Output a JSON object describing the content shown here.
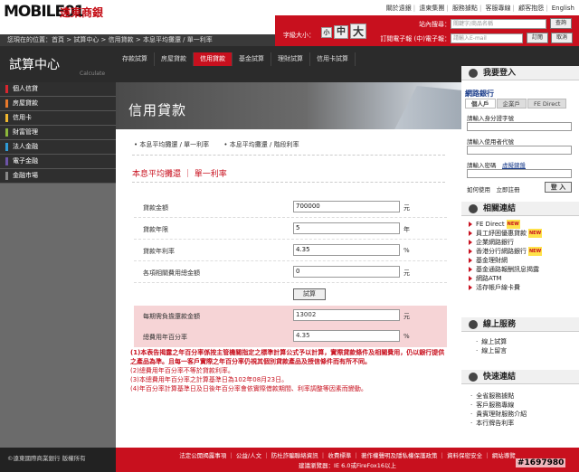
{
  "header": {
    "logo_watermark": "MOBILE01",
    "bank_name": "遠東商銀",
    "top_links": [
      "關於遠銀",
      "遠東集團",
      "服務據點",
      "客服專線",
      "顧客抱怨",
      "English"
    ],
    "font_size_label": "字級大小：",
    "font_sizes": [
      "小",
      "中",
      "大"
    ],
    "search_label": "站內搜尋：",
    "search_placeholder": "關鍵字/商品名稱",
    "search_button": "查詢",
    "subscribe_label": "訂閱電子報 (中)電子報：",
    "subscribe_placeholder": "請輸入E-mail",
    "subscribe_button": "訂閱",
    "unsubscribe_button": "取消",
    "breadcrumb": "您現在的位置：首頁 > 試算中心 > 信用貸款 > 本息平均攤還 / 單一利率"
  },
  "section": {
    "title": "試算中心",
    "subtitle": "Calculate"
  },
  "tabs": [
    "存款試算",
    "房屋貸款",
    "信用貸款",
    "基金試算",
    "理財試算",
    "信用卡試算"
  ],
  "active_tab": 2,
  "left_menu": [
    {
      "label": "個人信貸",
      "color": "#d9262f"
    },
    {
      "label": "房屋貸款",
      "color": "#e8792b"
    },
    {
      "label": "信用卡",
      "color": "#f0b72f"
    },
    {
      "label": "財富管理",
      "color": "#8cb83b"
    },
    {
      "label": "法人金融",
      "color": "#2f9bd6"
    },
    {
      "label": "電子金融",
      "color": "#6d54a8"
    },
    {
      "label": "金融市場",
      "color": "#888888"
    }
  ],
  "copyright": "©遠東國際商業銀行 版權所有",
  "hero": {
    "title": "信用貸款"
  },
  "subnav": [
    "• 本息平均攤還 / 單一利率",
    "• 本息平均攤還 / 階段利率"
  ],
  "form": {
    "title": "本息平均攤還 ｜ 單一利率",
    "rows": [
      {
        "label": "貸款金額",
        "value": "700000",
        "unit": "元"
      },
      {
        "label": "貸款年限",
        "value": "5",
        "unit": "年"
      },
      {
        "label": "貸款年利率",
        "value": "4.35",
        "unit": "%"
      },
      {
        "label": "各項相關費用總金額",
        "value": "0",
        "unit": "元"
      }
    ],
    "calc_button": "試算",
    "results": [
      {
        "label": "每期需負擔還款金額",
        "value": "13002",
        "unit": "元"
      },
      {
        "label": "總費用年百分率",
        "value": "4.35",
        "unit": "%"
      }
    ]
  },
  "notes": [
    "(1)本表告揭露之年百分率係按主管機關指定之標準計算公式予以計算，實際貸款條件及相關費用，仍以銀行提供之產品為準。且每一客戶實際之年百分率仍視其個別貸款產品及授信條件而有所不同。",
    "(2)總費用年百分率不等於貸款利率。",
    "(3)本總費用年百分率之計算基準日為102年08月23日。",
    "(4)年百分率計算基準日及日後年百分率會依實際借款期間、利率調整等因素而變動。"
  ],
  "login": {
    "title": "我要登入",
    "netbank": "網路銀行",
    "tabs": [
      "個人戶",
      "企業戶",
      "FE Direct"
    ],
    "id_label": "請輸入身分證字號",
    "user_label": "請輸入使用者代號",
    "pwd_label": "請輸入密碼",
    "virtual_kb": "虛擬鍵盤",
    "howto": "如何使用",
    "apply": "立即註冊",
    "login_button": "登 入"
  },
  "related": {
    "title": "相關連結",
    "items": [
      {
        "label": "FE Direct",
        "new": true
      },
      {
        "label": "員工紓困優惠貸款",
        "new": true
      },
      {
        "label": "企業網路銀行",
        "new": false
      },
      {
        "label": "香港分行網路銀行",
        "new": true
      },
      {
        "label": "基金理財網",
        "new": false
      },
      {
        "label": "基金通路報酬訊息揭露",
        "new": false
      },
      {
        "label": "網路ATM",
        "new": false
      },
      {
        "label": "活存帳戶線卡費",
        "new": false
      }
    ],
    "new_label": "NEW"
  },
  "online": {
    "title": "線上服務",
    "items": [
      "線上試算",
      "線上留言"
    ]
  },
  "quick": {
    "title": "快速連結",
    "items": [
      "全省服務據點",
      "客戶服務專線",
      "貴賓理財服務介紹",
      "本行牌告利率"
    ]
  },
  "footer": {
    "links": "法定公開揭露事項 ｜ 公益/人文 ｜ 防杜詐騙聯絡資訊 ｜ 收費標準 ｜ 著作權聲明及隱私權保護政策 ｜ 資料保密安全 ｜ 網站導覽",
    "note": "建議瀏覽器：IE 6.0或FireFox16以上"
  },
  "watermark_id": "#1697980"
}
